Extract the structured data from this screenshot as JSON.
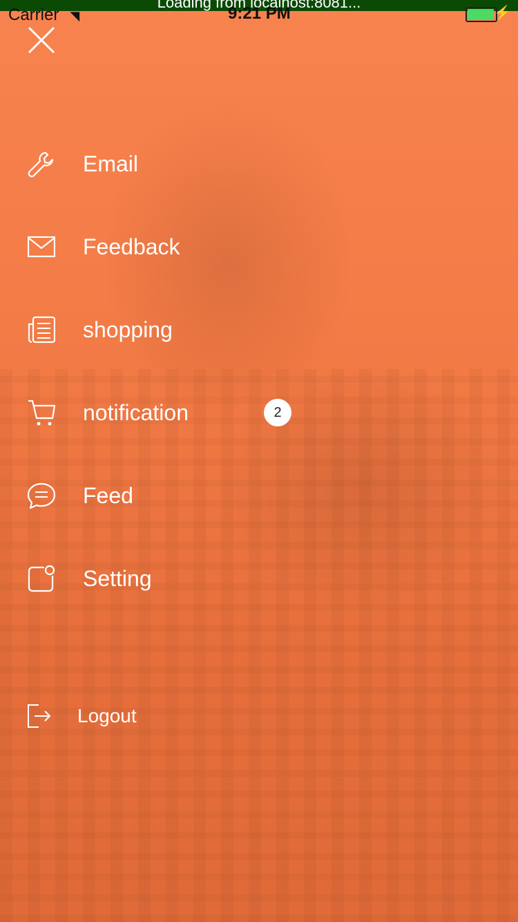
{
  "status_bar": {
    "loading_text": "Loading from localhost:8081...",
    "carrier": "Carrier",
    "time": "9:21 PM",
    "battery_color": "#4cd964"
  },
  "close_icon": "close-icon",
  "menu": [
    {
      "label": "Email",
      "icon": "wrench-icon"
    },
    {
      "label": "Feedback",
      "icon": "envelope-icon"
    },
    {
      "label": "shopping",
      "icon": "newspaper-icon"
    },
    {
      "label": "notification",
      "icon": "cart-icon",
      "badge": "2"
    },
    {
      "label": "Feed",
      "icon": "chat-bubble-icon"
    },
    {
      "label": "Setting",
      "icon": "settings-square-icon"
    }
  ],
  "logout": {
    "label": "Logout",
    "icon": "logout-icon"
  },
  "colors": {
    "overlay": "#f07a45",
    "text": "#ffffff"
  }
}
